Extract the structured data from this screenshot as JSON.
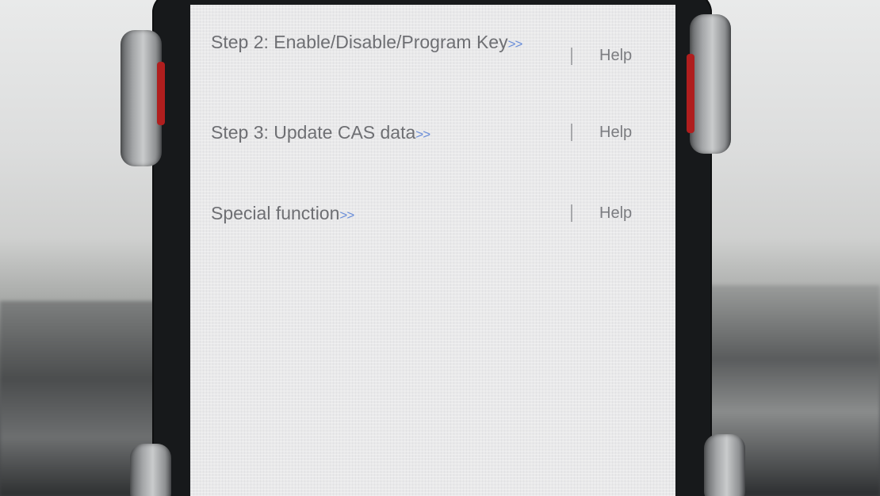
{
  "menu": {
    "items": [
      {
        "label": "Step 2: Enable/Disable/Program Key",
        "arrow": ">>",
        "help": "Help"
      },
      {
        "label": "Step 3: Update CAS data",
        "arrow": ">>",
        "help": "Help"
      },
      {
        "label": "Special function",
        "arrow": ">>",
        "help": "Help"
      }
    ]
  },
  "colors": {
    "screen_bg": "#e9e9ea",
    "text": "#6e6f73",
    "arrow_accent": "#6b8ed8",
    "phone_body": "#17191b",
    "holder_red": "#b01e1e"
  }
}
